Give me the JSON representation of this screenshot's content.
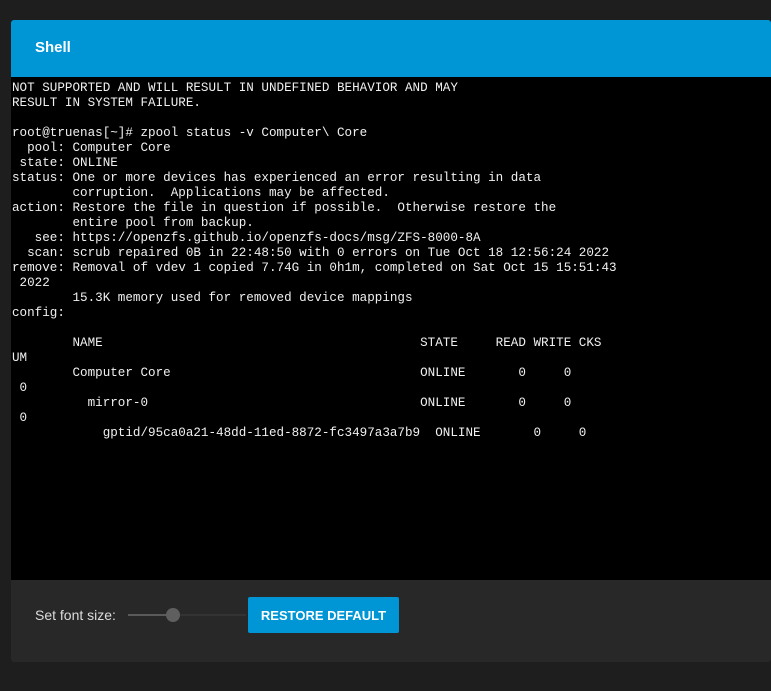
{
  "shell": {
    "title": "Shell",
    "terminal_output": "NOT SUPPORTED AND WILL RESULT IN UNDEFINED BEHAVIOR AND MAY\nRESULT IN SYSTEM FAILURE.\n\nroot@truenas[~]# zpool status -v Computer\\ Core\n  pool: Computer Core\n state: ONLINE\nstatus: One or more devices has experienced an error resulting in data\n        corruption.  Applications may be affected.\naction: Restore the file in question if possible.  Otherwise restore the\n        entire pool from backup.\n   see: https://openzfs.github.io/openzfs-docs/msg/ZFS-8000-8A\n  scan: scrub repaired 0B in 22:48:50 with 0 errors on Tue Oct 18 12:56:24 2022\nremove: Removal of vdev 1 copied 7.74G in 0h1m, completed on Sat Oct 15 15:51:43\n 2022\n        15.3K memory used for removed device mappings\nconfig:\n\n        NAME                                          STATE     READ WRITE CKS\nUM\n        Computer Core                                 ONLINE       0     0\n 0\n          mirror-0                                    ONLINE       0     0\n 0\n            gptid/95ca0a21-48dd-11ed-8872-fc3497a3a7b9  ONLINE       0     0"
  },
  "footer": {
    "font_size_label": "Set font size:",
    "font_size_level": 0.35,
    "restore_button_label": "RESTORE DEFAULT"
  },
  "colors": {
    "accent": "#0095d5",
    "terminal_bg": "#000000",
    "card_bg": "#282828",
    "page_bg": "#1e1e1e"
  }
}
